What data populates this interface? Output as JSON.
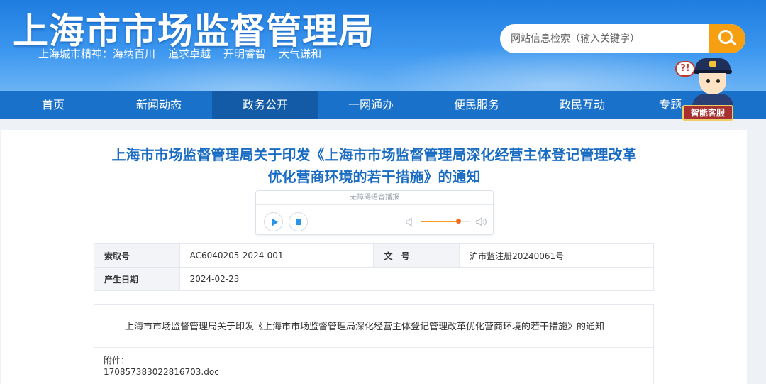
{
  "header": {
    "site_title": "上海市市场监督管理局",
    "slogan_prefix": "上海城市精神：",
    "slogan_items": [
      "海纳百川",
      "追求卓越",
      "开明睿智",
      "大气谦和"
    ],
    "search_placeholder": "网站信息检索（输入关键字）",
    "accent_color": "#f6a011"
  },
  "nav": {
    "items": [
      "首页",
      "新闻动态",
      "政务公开",
      "一网通办",
      "便民服务",
      "政民互动",
      "专题"
    ],
    "active_index": 2
  },
  "service": {
    "bubble": "?!",
    "label": "智能客服",
    "icon": "customer-service-robot-icon"
  },
  "article": {
    "title_line1": "上海市市场监督管理局关于印发《上海市市场监督管理局深化经营主体登记管理改革",
    "title_line2": "优化营商环境的若干措施》的通知",
    "player": {
      "label": "无障碍语音播报",
      "volume_fraction": 0.75
    },
    "info": {
      "index_label": "索取号",
      "index_value": "AC6040205-2024-001",
      "doc_no_label": "文　号",
      "doc_no_value": "沪市监注册20240061号",
      "date_label": "产生日期",
      "date_value": "2024-02-23"
    },
    "body_text": "上海市市场监督管理局关于印发《上海市市场监督管理局深化经营主体登记管理改革优化营商环境的若干措施》的通知",
    "attachment_label": "附件：",
    "attachment_file": "170857383022816703.doc"
  }
}
